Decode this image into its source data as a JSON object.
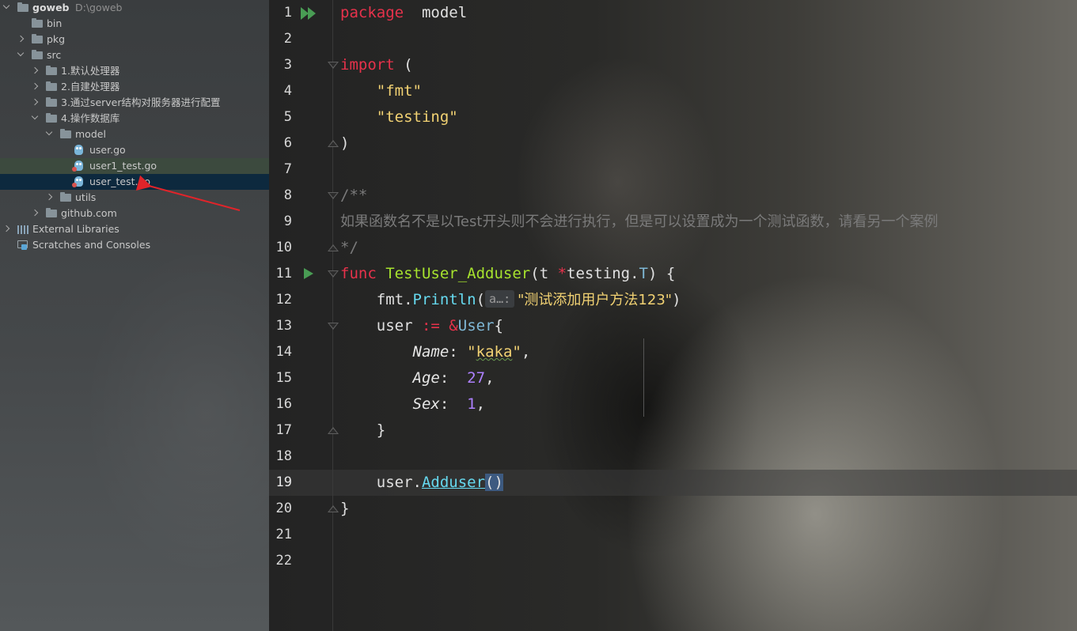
{
  "project_tree": {
    "items": [
      {
        "label": "goweb",
        "sub": "D:\\goweb",
        "depth": 0,
        "expanded": true,
        "icon": "folder-icon",
        "bold": true
      },
      {
        "label": "bin",
        "depth": 1,
        "expanded": null,
        "icon": "folder-icon"
      },
      {
        "label": "pkg",
        "depth": 1,
        "expanded": false,
        "icon": "folder-icon"
      },
      {
        "label": "src",
        "depth": 1,
        "expanded": true,
        "icon": "folder-icon"
      },
      {
        "label": "1.默认处理器",
        "depth": 2,
        "expanded": false,
        "icon": "folder-icon"
      },
      {
        "label": "2.自建处理器",
        "depth": 2,
        "expanded": false,
        "icon": "folder-icon"
      },
      {
        "label": "3.通过server结构对服务器进行配置",
        "depth": 2,
        "expanded": false,
        "icon": "folder-icon"
      },
      {
        "label": "4.操作数据库",
        "depth": 2,
        "expanded": true,
        "icon": "folder-icon"
      },
      {
        "label": "model",
        "depth": 3,
        "expanded": true,
        "icon": "folder-icon"
      },
      {
        "label": "user.go",
        "depth": 4,
        "expanded": null,
        "icon": "go-file-icon"
      },
      {
        "label": "user1_test.go",
        "depth": 4,
        "expanded": null,
        "icon": "go-test-file-icon",
        "state": "hover"
      },
      {
        "label": "user_test.go",
        "depth": 4,
        "expanded": null,
        "icon": "go-test-file-icon",
        "state": "selected"
      },
      {
        "label": "utils",
        "depth": 3,
        "expanded": false,
        "icon": "folder-icon"
      },
      {
        "label": "github.com",
        "depth": 2,
        "expanded": false,
        "icon": "folder-icon"
      },
      {
        "label": "External Libraries",
        "depth": 0,
        "expanded": false,
        "icon": "library-icon"
      },
      {
        "label": "Scratches and Consoles",
        "depth": 0,
        "expanded": null,
        "icon": "scratch-icon"
      }
    ]
  },
  "editor": {
    "current_line": 19,
    "lines": [
      {
        "n": "1",
        "tokens": [
          [
            "kw",
            "package"
          ],
          [
            "",
            "  model"
          ]
        ],
        "gutter": "run-all-icon"
      },
      {
        "n": "2",
        "tokens": []
      },
      {
        "n": "3",
        "tokens": [
          [
            "kw",
            "import"
          ],
          [
            "",
            " ("
          ]
        ],
        "fold": "open"
      },
      {
        "n": "4",
        "tokens": [
          [
            "",
            "    "
          ],
          [
            "str",
            "\"fmt\""
          ]
        ]
      },
      {
        "n": "5",
        "tokens": [
          [
            "",
            "    "
          ],
          [
            "str",
            "\"testing\""
          ]
        ]
      },
      {
        "n": "6",
        "tokens": [
          [
            "",
            ")"
          ]
        ],
        "fold": "close"
      },
      {
        "n": "7",
        "tokens": []
      },
      {
        "n": "8",
        "tokens": [
          [
            "cmt",
            "/**"
          ]
        ],
        "fold": "open"
      },
      {
        "n": "9",
        "tokens": [
          [
            "cmt cmt-cn",
            "如果函数名不是以Test开头则不会进行执行，但是可以设置成为一个测试函数，请看另一个案例"
          ]
        ]
      },
      {
        "n": "10",
        "tokens": [
          [
            "cmt",
            "*/"
          ]
        ],
        "fold": "close"
      },
      {
        "n": "11",
        "tokens": [
          [
            "kw",
            "func"
          ],
          [
            "",
            " "
          ],
          [
            "fn",
            "TestUser_Adduser"
          ],
          [
            "",
            "(t "
          ],
          [
            "ptr",
            "*"
          ],
          [
            "",
            "testing."
          ],
          [
            "typ",
            "T"
          ],
          [
            "",
            ") {"
          ]
        ],
        "gutter": "run-test-icon",
        "fold": "open"
      },
      {
        "n": "12",
        "tokens": [
          [
            "",
            "    fmt."
          ],
          [
            "meth",
            "Println"
          ],
          [
            "",
            "("
          ],
          [
            "hint",
            "a…:"
          ],
          [
            "str cnstr",
            "\"测试添加用户方法123\""
          ],
          [
            "",
            ")"
          ]
        ]
      },
      {
        "n": "13",
        "tokens": [
          [
            "",
            "    user "
          ],
          [
            "op",
            ":="
          ],
          [
            "",
            " "
          ],
          [
            "op",
            "&"
          ],
          [
            "typ",
            "User"
          ],
          [
            "",
            "{"
          ]
        ],
        "fold": "open"
      },
      {
        "n": "14",
        "tokens": [
          [
            "",
            "        "
          ],
          [
            "fld",
            "Name"
          ],
          [
            "",
            ": "
          ],
          [
            "str",
            "\""
          ],
          [
            "str wavy",
            "kaka"
          ],
          [
            "str",
            "\""
          ],
          [
            "",
            ","
          ]
        ]
      },
      {
        "n": "15",
        "tokens": [
          [
            "",
            "        "
          ],
          [
            "fld",
            "Age"
          ],
          [
            "",
            ":  "
          ],
          [
            "num",
            "27"
          ],
          [
            "",
            ","
          ]
        ]
      },
      {
        "n": "16",
        "tokens": [
          [
            "",
            "        "
          ],
          [
            "fld",
            "Sex"
          ],
          [
            "",
            ":  "
          ],
          [
            "num",
            "1"
          ],
          [
            "",
            ","
          ]
        ]
      },
      {
        "n": "17",
        "tokens": [
          [
            "",
            "    }"
          ]
        ],
        "fold": "close"
      },
      {
        "n": "18",
        "tokens": []
      },
      {
        "n": "19",
        "tokens": [
          [
            "",
            "    user."
          ],
          [
            "methcall",
            "Adduser"
          ],
          [
            "parenhl",
            "()"
          ]
        ]
      },
      {
        "n": "20",
        "tokens": [
          [
            "",
            "}"
          ]
        ],
        "fold": "close"
      },
      {
        "n": "21",
        "tokens": []
      },
      {
        "n": "22",
        "tokens": []
      }
    ]
  },
  "colors": {
    "keyword": "#e6324b",
    "string": "#f2d273",
    "function": "#a6e22e",
    "number": "#ae81ff",
    "method": "#66d9ef",
    "comment": "#7a7a7a",
    "run_icon": "#499c54",
    "annotation_arrow": "#e0242a"
  },
  "annotation": {
    "icon": "red-arrow-icon"
  }
}
